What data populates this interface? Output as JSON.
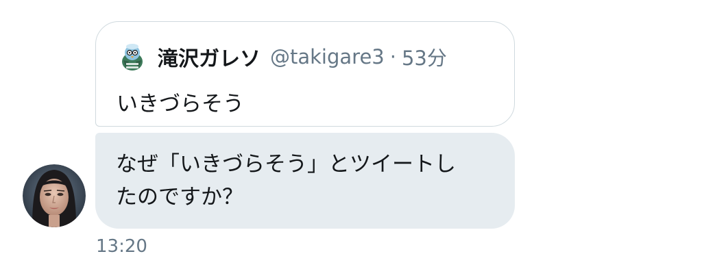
{
  "quoted_tweet": {
    "display_name": "滝沢ガレソ",
    "handle": "@takigare3",
    "separator": "·",
    "time_ago": "53分",
    "text": "いきづらそう",
    "avatar_icon": "bird-character-avatar"
  },
  "message": {
    "line1": "なぜ「いきづらそう」とツイートし",
    "line2": "たのですか？",
    "timestamp": "13:20",
    "sender_avatar": "woman-portrait-avatar"
  },
  "colors": {
    "bubble_background": "#e6ecf0",
    "card_border": "#cfd9de",
    "secondary_text": "#657786",
    "primary_text": "#14171a"
  }
}
